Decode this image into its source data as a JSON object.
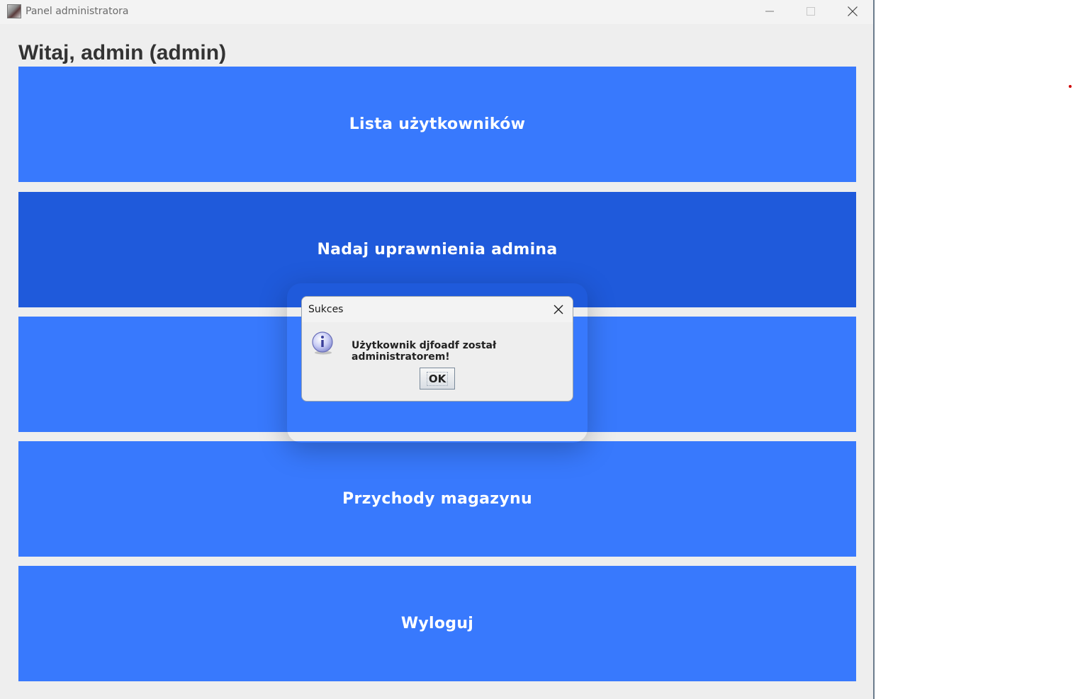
{
  "window": {
    "title": "Panel administratora",
    "controls": {
      "minimize_icon": "minimize-icon",
      "maximize_icon": "maximize-icon",
      "close_icon": "close-icon"
    }
  },
  "header": {
    "greeting": "Witaj, admin (admin)"
  },
  "menu": {
    "items": [
      {
        "label": "Lista użytkowników",
        "active": false
      },
      {
        "label": "Nadaj uprawnienia admina",
        "active": true
      },
      {
        "label": "",
        "active": false
      },
      {
        "label": "Przychody magazynu",
        "active": false
      },
      {
        "label": "Wyloguj",
        "active": false
      }
    ]
  },
  "dialog": {
    "title": "Sukces",
    "message": "Użytkownik djfoadf został administratorem!",
    "ok_label": "OK",
    "icon": "info-icon"
  },
  "colors": {
    "button": "#3879fd",
    "button_active": "#1f5adb",
    "background": "#eeeeee"
  }
}
